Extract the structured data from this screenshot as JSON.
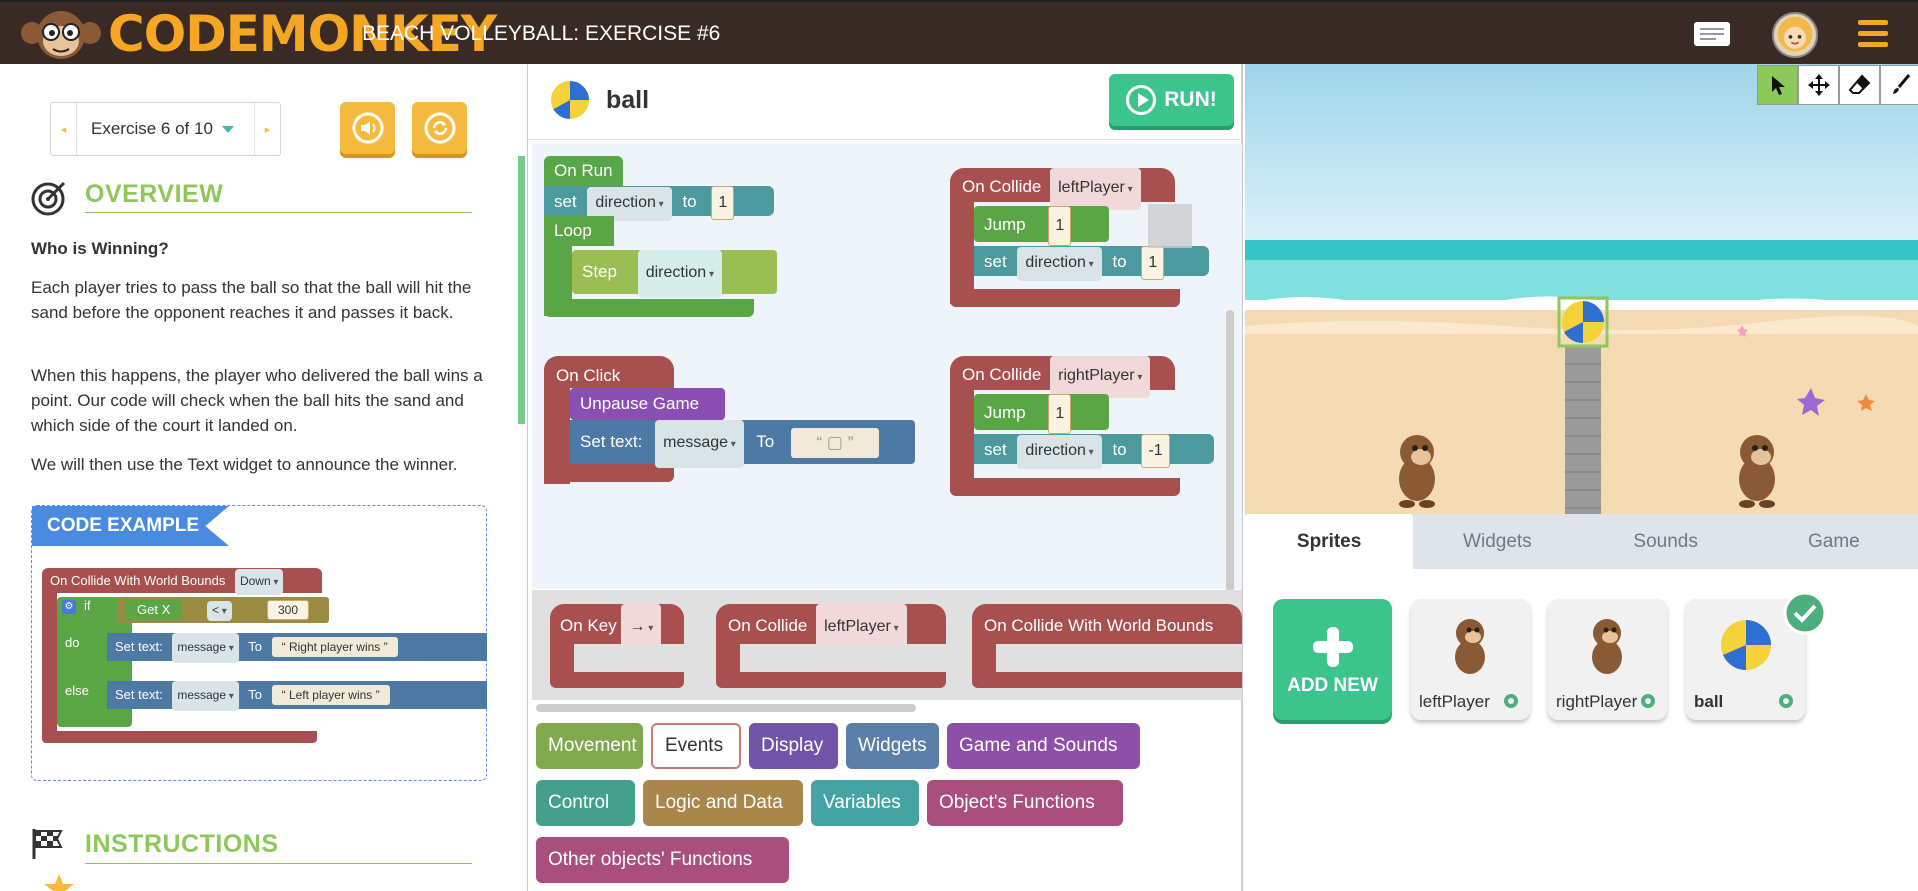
{
  "header": {
    "logo_text": "CODEMONKEY",
    "title": "BEACH VOLLEYBALL: EXERCISE #6"
  },
  "left": {
    "exercise_label": "Exercise 6 of 10",
    "overview_title": "OVERVIEW",
    "question": "Who is Winning?",
    "paragraphs": [
      "Each player tries to pass the ball so that the ball will hit the sand before the opponent reaches it and passes it back.",
      "When this happens, the player who delivered the ball wins a point. Our code will check when the ball hits the sand and which side of the court it landed on.",
      "We will then use the Text widget to announce the winner."
    ],
    "code_example_title": "CODE EXAMPLE",
    "code_example": {
      "event": "On Collide With World Bounds",
      "event_dropdown": "Down",
      "if_label": "if",
      "get_label": "Get X",
      "compare_op": "<",
      "compare_value": "300",
      "do_label": "do",
      "else_label": "else",
      "set_text_label": "Set text:",
      "message_field": "message",
      "to_label": "To",
      "right_text": "Right player wins",
      "left_text": "Left player wins"
    },
    "instructions_title": "INSTRUCTIONS"
  },
  "workspace": {
    "object_name": "ball",
    "run_label": "RUN!",
    "blocks": {
      "on_run": "On Run",
      "set": "set",
      "direction": "direction",
      "to": "to",
      "one": "1",
      "loop": "Loop",
      "step": "Step",
      "on_collide": "On Collide",
      "left_player": "leftPlayer",
      "right_player": "rightPlayer",
      "jump": "Jump",
      "neg_one": "-1",
      "on_click": "On Click",
      "unpause": "Unpause Game",
      "set_text": "Set text:",
      "message": "message",
      "to_cap": "To"
    },
    "flyout": {
      "on_key": "On Key",
      "key_arrow": "→",
      "on_collide": "On Collide",
      "left_player": "leftPlayer",
      "world_bounds": "On Collide With World Bounds"
    },
    "categories": [
      {
        "label": "Movement",
        "color": "#7fa94c"
      },
      {
        "label": "Events",
        "color": "#ffffff"
      },
      {
        "label": "Display",
        "color": "#7153a8"
      },
      {
        "label": "Widgets",
        "color": "#5b7fa8"
      },
      {
        "label": "Game and Sounds",
        "color": "#8e4fa8"
      },
      {
        "label": "Control",
        "color": "#44a08a"
      },
      {
        "label": "Logic and Data",
        "color": "#a9874c"
      },
      {
        "label": "Variables",
        "color": "#46a3a3"
      },
      {
        "label": "Object's Functions",
        "color": "#a94f7e"
      },
      {
        "label": "Other objects' Functions",
        "color": "#a94f7e"
      }
    ]
  },
  "stage": {
    "tabs": [
      "Sprites",
      "Widgets",
      "Sounds",
      "Game"
    ],
    "add_new": "ADD NEW",
    "sprites": [
      {
        "name": "leftPlayer"
      },
      {
        "name": "rightPlayer"
      },
      {
        "name": "ball"
      }
    ]
  }
}
